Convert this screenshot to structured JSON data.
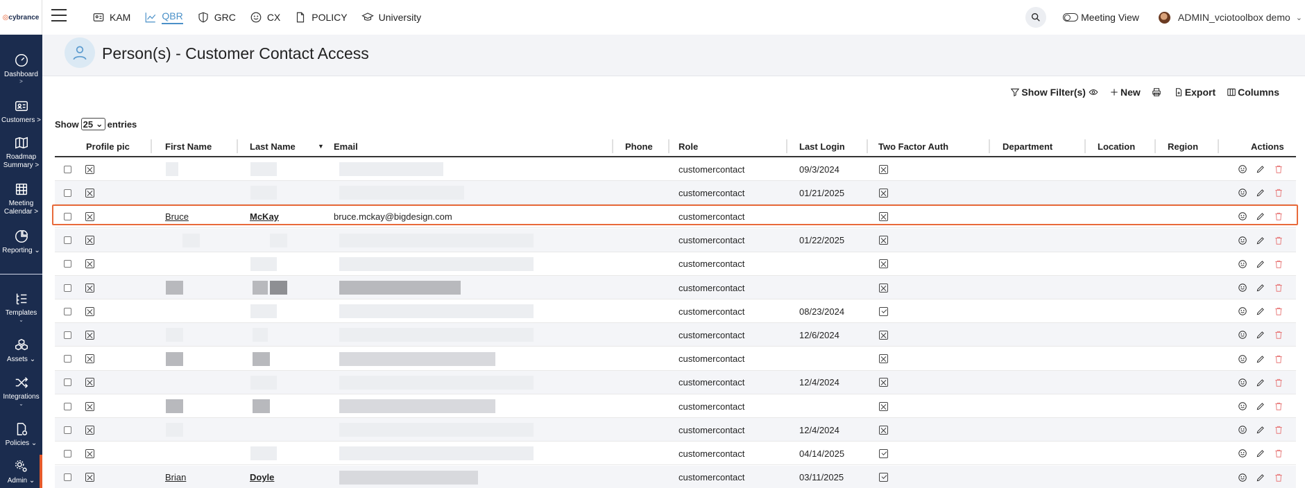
{
  "app": {
    "logo_text": "cybrance"
  },
  "sidebar": {
    "items": [
      {
        "label": "Dashboard",
        "icon": "gauge-icon"
      },
      {
        "label": "Customers",
        "icon": "id-card-icon"
      },
      {
        "label": "Roadmap Summary",
        "icon": "map-icon"
      },
      {
        "label": "Meeting Calendar",
        "icon": "calendar-icon"
      },
      {
        "label": "Reporting",
        "icon": "pie-chart-icon"
      },
      {
        "label": "Templates",
        "icon": "list-icon"
      },
      {
        "label": "Assets",
        "icon": "boxes-icon"
      },
      {
        "label": "Integrations",
        "icon": "shuffle-icon"
      },
      {
        "label": "Policies",
        "icon": "policy-icon"
      },
      {
        "label": "Admin",
        "icon": "admin-gears-icon"
      }
    ]
  },
  "topnav": {
    "tabs": [
      {
        "label": "KAM",
        "icon": "contact-card-icon",
        "active": false
      },
      {
        "label": "QBR",
        "icon": "line-chart-icon",
        "active": true
      },
      {
        "label": "GRC",
        "icon": "shield-icon",
        "active": false
      },
      {
        "label": "CX",
        "icon": "smiley-icon",
        "active": false
      },
      {
        "label": "POLICY",
        "icon": "document-icon",
        "active": false
      },
      {
        "label": "University",
        "icon": "graduation-cap-icon",
        "active": false
      }
    ],
    "meeting_view": "Meeting View",
    "user": "ADMIN_vciotoolbox demo"
  },
  "page": {
    "title": "Person(s) - Customer Contact Access"
  },
  "toolbar": {
    "show_filters": "Show Filter(s)",
    "new": "New",
    "export": "Export",
    "columns": "Columns"
  },
  "entries": {
    "show": "Show",
    "value": "25",
    "suffix": "entries"
  },
  "table": {
    "headers": [
      "Profile pic",
      "First Name",
      "Last Name",
      "Email",
      "Phone",
      "Role",
      "Last Login",
      "Two Factor Auth",
      "Department",
      "Location",
      "Region",
      "Actions"
    ],
    "rows": [
      {
        "first": "",
        "last": "",
        "email": "",
        "role": "customercontact",
        "last_login": "09/3/2024",
        "tfa": "x"
      },
      {
        "first": "",
        "last": "",
        "email": "",
        "role": "customercontact",
        "last_login": "01/21/2025",
        "tfa": "x"
      },
      {
        "first": "Bruce",
        "last": "McKay",
        "email": "bruce.mckay@bigdesign.com",
        "role": "customercontact",
        "last_login": "",
        "tfa": "x"
      },
      {
        "first": "",
        "last": "",
        "email": "",
        "role": "customercontact",
        "last_login": "01/22/2025",
        "tfa": "x"
      },
      {
        "first": "",
        "last": "",
        "email": "",
        "role": "customercontact",
        "last_login": "",
        "tfa": "x"
      },
      {
        "first": "",
        "last": "",
        "email": "",
        "role": "customercontact",
        "last_login": "",
        "tfa": "x"
      },
      {
        "first": "",
        "last": "",
        "email": "",
        "role": "customercontact",
        "last_login": "08/23/2024",
        "tfa": "check"
      },
      {
        "first": "",
        "last": "",
        "email": "",
        "role": "customercontact",
        "last_login": "12/6/2024",
        "tfa": "x"
      },
      {
        "first": "",
        "last": "",
        "email": "",
        "role": "customercontact",
        "last_login": "",
        "tfa": "x"
      },
      {
        "first": "",
        "last": "",
        "email": "",
        "role": "customercontact",
        "last_login": "12/4/2024",
        "tfa": "x"
      },
      {
        "first": "",
        "last": "",
        "email": "",
        "role": "customercontact",
        "last_login": "",
        "tfa": "x"
      },
      {
        "first": "",
        "last": "",
        "email": "",
        "role": "customercontact",
        "last_login": "12/4/2024",
        "tfa": "x"
      },
      {
        "first": "",
        "last": "",
        "email": "",
        "role": "customercontact",
        "last_login": "04/14/2025",
        "tfa": "check"
      },
      {
        "first": "Brian",
        "last": "Doyle",
        "email": "",
        "role": "customercontact",
        "last_login": "03/11/2025",
        "tfa": "check"
      }
    ]
  },
  "colors": {
    "sidebar_bg": "#1b2c4e",
    "accent": "#e65a2b",
    "active_tab": "#4a90c8",
    "delete_icon": "#e87878"
  }
}
